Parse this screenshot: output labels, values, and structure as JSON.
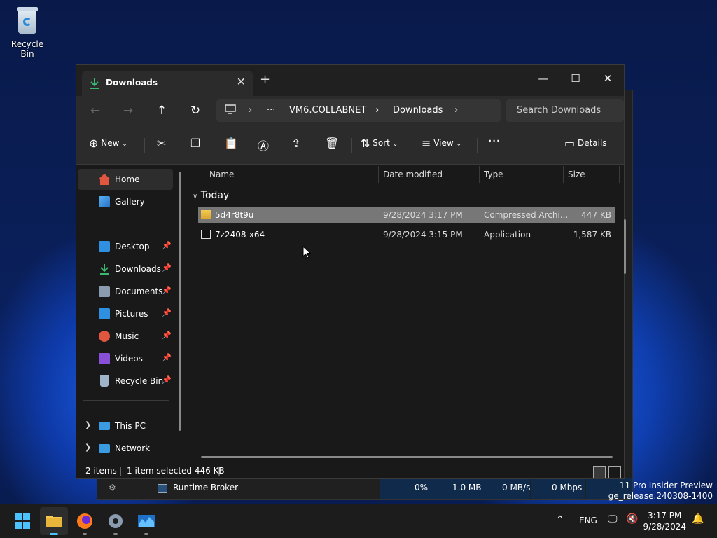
{
  "desktop": {
    "recycle_bin_label": "Recycle Bin",
    "edition_line1": "11 Pro Insider Preview",
    "edition_line2": "ge_release.240308-1400"
  },
  "background_window": {
    "row_name": "Runtime Broker",
    "cpu": "0%",
    "memory": "1.0 MB",
    "disk": "0 MB/s",
    "network": "0 Mbps"
  },
  "explorer": {
    "tab_title": "Downloads",
    "breadcrumb": {
      "more": "···",
      "pc": "VM6.COLLABNET",
      "folder": "Downloads"
    },
    "search_placeholder": "Search Downloads",
    "toolbar": {
      "new_label": "New",
      "sort_label": "Sort",
      "view_label": "View",
      "more_label": "···",
      "details_label": "Details"
    },
    "nav": {
      "home": "Home",
      "gallery": "Gallery",
      "quick": [
        {
          "label": "Desktop",
          "color": "#2f8fe0"
        },
        {
          "label": "Downloads",
          "color": "#3bb870"
        },
        {
          "label": "Documents",
          "color": "#8a9bb0"
        },
        {
          "label": "Pictures",
          "color": "#2f8fe0"
        },
        {
          "label": "Music",
          "color": "#e0563f"
        },
        {
          "label": "Videos",
          "color": "#8a4fd8"
        },
        {
          "label": "Recycle Bin",
          "color": "#9fb4c8"
        }
      ],
      "this_pc": "This PC",
      "network": "Network"
    },
    "columns": {
      "name": "Name",
      "date": "Date modified",
      "type": "Type",
      "size": "Size"
    },
    "group_label": "Today",
    "files": [
      {
        "name": "5d4r8t9u",
        "date": "9/28/2024 3:17 PM",
        "type": "Compressed Archi...",
        "size": "447 KB",
        "selected": true
      },
      {
        "name": "7z2408-x64",
        "date": "9/28/2024 3:15 PM",
        "type": "Application",
        "size": "1,587 KB",
        "selected": false
      }
    ],
    "status": {
      "items": "2 items",
      "selected": "1 item selected  446 KB"
    }
  },
  "taskbar": {
    "tray_lang": "ENG",
    "time": "3:17 PM",
    "date": "9/28/2024"
  },
  "colors": {
    "accent": "#4cc2ff",
    "selection": "#777777",
    "window_bg": "#191919"
  }
}
